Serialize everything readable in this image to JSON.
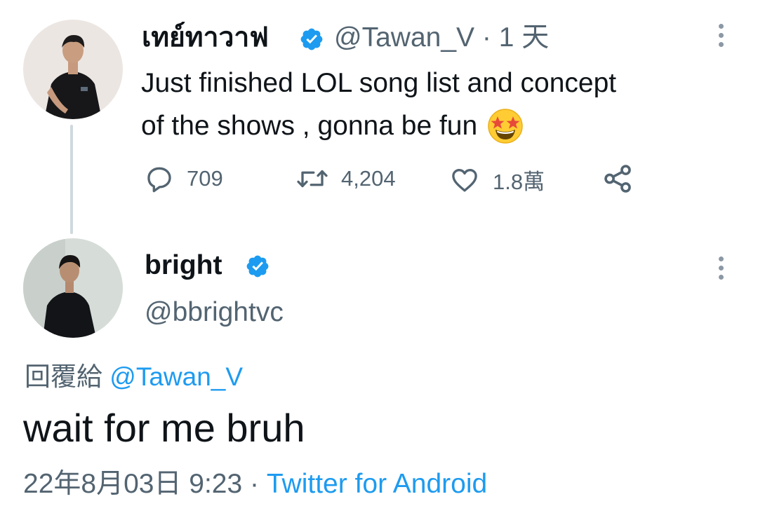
{
  "parent_tweet": {
    "display_name": "เทย์ทาวาฟ",
    "handle": "@Tawan_V",
    "separator": "·",
    "time_ago": "1 天",
    "text_line1": "Just finished LOL song list and concept",
    "text_line2": "of the shows , gonna be fun",
    "emoji": "star-struck-emoji",
    "actions": {
      "replies": "709",
      "retweets": "4,204",
      "likes": "1.8萬"
    }
  },
  "reply_tweet": {
    "display_name": "bright",
    "handle": "@bbrightvc",
    "replying_to_label": "回覆給",
    "replying_to_handle": "@Tawan_V",
    "text": "wait for me bruh",
    "timestamp": "22年8月03日 9:23",
    "separator": "·",
    "source": "Twitter for Android"
  },
  "icons": {
    "verified": "verified-badge-icon",
    "more": "more-vertical-icon",
    "reply": "reply-icon",
    "retweet": "retweet-icon",
    "like": "heart-icon",
    "share": "share-icon"
  },
  "colors": {
    "accent": "#1d9bf0",
    "text": "#0f1419",
    "muted": "#536471",
    "thread_line": "#cfd9de"
  }
}
